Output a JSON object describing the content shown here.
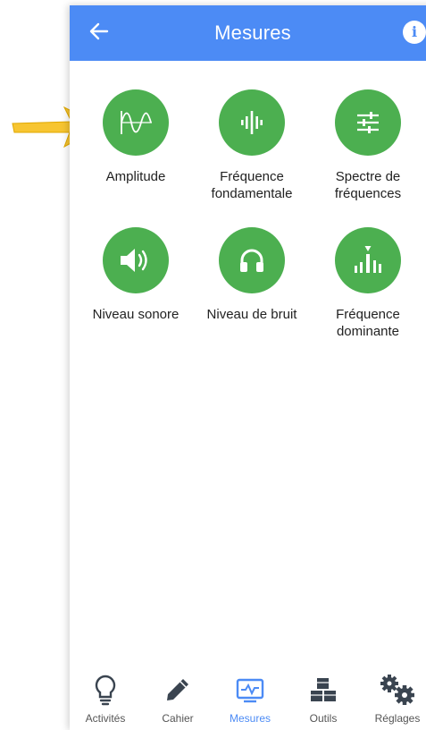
{
  "appbar": {
    "title": "Mesures",
    "back_icon": "arrow-left-icon",
    "info_label": "i",
    "color": "#4c8bf5"
  },
  "measures": [
    {
      "label": "Amplitude",
      "icon": "amplitude-wave-icon"
    },
    {
      "label": "Fréquence fondamentale",
      "icon": "audio-bars-icon"
    },
    {
      "label": "Spectre de fréquences",
      "icon": "sliders-icon"
    },
    {
      "label": "Niveau sonore",
      "icon": "speaker-icon"
    },
    {
      "label": "Niveau de bruit",
      "icon": "headphones-icon"
    },
    {
      "label": "Fréquence dominante",
      "icon": "dominant-frequency-icon"
    }
  ],
  "accent_green": "#4caf50",
  "pointer_color": "#f7c531",
  "nav": {
    "items": [
      {
        "label": "Activités",
        "icon": "lightbulb-icon"
      },
      {
        "label": "Cahier",
        "icon": "pencil-icon"
      },
      {
        "label": "Mesures",
        "icon": "waveform-monitor-icon",
        "active": true
      },
      {
        "label": "Outils",
        "icon": "cubes-icon"
      },
      {
        "label": "Réglages",
        "icon": "gears-icon"
      }
    ]
  }
}
